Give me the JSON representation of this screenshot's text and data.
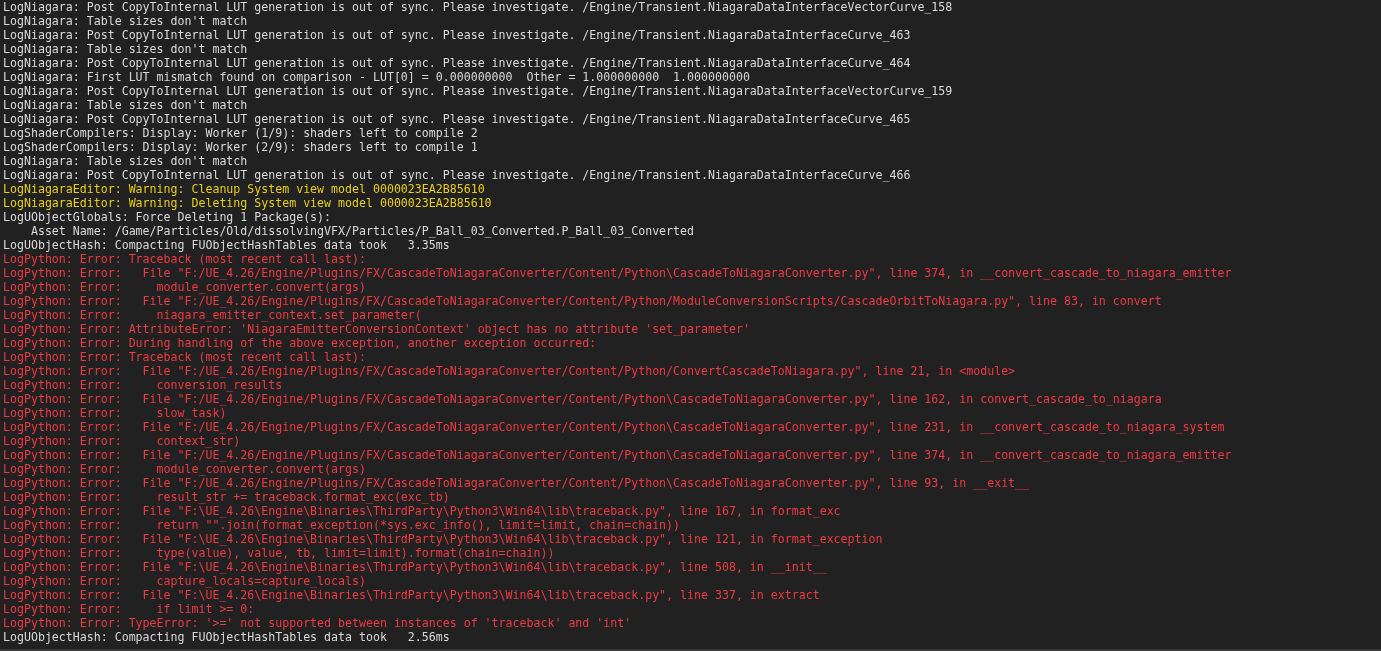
{
  "log_lines": [
    {
      "kind": "info",
      "text": "LogNiagara: Post CopyToInternal LUT generation is out of sync. Please investigate. /Engine/Transient.NiagaraDataInterfaceVectorCurve_158"
    },
    {
      "kind": "info",
      "text": "LogNiagara: Table sizes don't match"
    },
    {
      "kind": "info",
      "text": "LogNiagara: Post CopyToInternal LUT generation is out of sync. Please investigate. /Engine/Transient.NiagaraDataInterfaceCurve_463"
    },
    {
      "kind": "info",
      "text": "LogNiagara: Table sizes don't match"
    },
    {
      "kind": "info",
      "text": "LogNiagara: Post CopyToInternal LUT generation is out of sync. Please investigate. /Engine/Transient.NiagaraDataInterfaceCurve_464"
    },
    {
      "kind": "info",
      "text": "LogNiagara: First LUT mismatch found on comparison - LUT[0] = 0.000000000  Other = 1.000000000  1.000000000"
    },
    {
      "kind": "info",
      "text": "LogNiagara: Post CopyToInternal LUT generation is out of sync. Please investigate. /Engine/Transient.NiagaraDataInterfaceVectorCurve_159"
    },
    {
      "kind": "info",
      "text": "LogNiagara: Table sizes don't match"
    },
    {
      "kind": "info",
      "text": "LogNiagara: Post CopyToInternal LUT generation is out of sync. Please investigate. /Engine/Transient.NiagaraDataInterfaceCurve_465"
    },
    {
      "kind": "info",
      "text": "LogShaderCompilers: Display: Worker (1/9): shaders left to compile 2"
    },
    {
      "kind": "info",
      "text": "LogShaderCompilers: Display: Worker (2/9): shaders left to compile 1"
    },
    {
      "kind": "info",
      "text": "LogNiagara: Table sizes don't match"
    },
    {
      "kind": "info",
      "text": "LogNiagara: Post CopyToInternal LUT generation is out of sync. Please investigate. /Engine/Transient.NiagaraDataInterfaceCurve_466"
    },
    {
      "kind": "warning",
      "text": "LogNiagaraEditor: Warning: Cleanup System view model 0000023EA2B85610"
    },
    {
      "kind": "warning",
      "text": "LogNiagaraEditor: Warning: Deleting System view model 0000023EA2B85610"
    },
    {
      "kind": "info",
      "text": "LogUObjectGlobals: Force Deleting 1 Package(s):"
    },
    {
      "kind": "info",
      "text": "    Asset Name: /Game/Particles/Old/dissolvingVFX/Particles/P_Ball_03_Converted.P_Ball_03_Converted"
    },
    {
      "kind": "info",
      "text": "LogUObjectHash: Compacting FUObjectHashTables data took   3.35ms"
    },
    {
      "kind": "error",
      "text": "LogPython: Error: Traceback (most recent call last):"
    },
    {
      "kind": "error",
      "text": "LogPython: Error:   File \"F:/UE_4.26/Engine/Plugins/FX/CascadeToNiagaraConverter/Content/Python\\CascadeToNiagaraConverter.py\", line 374, in __convert_cascade_to_niagara_emitter"
    },
    {
      "kind": "error",
      "text": "LogPython: Error:     module_converter.convert(args)"
    },
    {
      "kind": "error",
      "text": "LogPython: Error:   File \"F:/UE_4.26/Engine/Plugins/FX/CascadeToNiagaraConverter/Content/Python/ModuleConversionScripts/CascadeOrbitToNiagara.py\", line 83, in convert"
    },
    {
      "kind": "error",
      "text": "LogPython: Error:     niagara_emitter_context.set_parameter("
    },
    {
      "kind": "error",
      "text": "LogPython: Error: AttributeError: 'NiagaraEmitterConversionContext' object has no attribute 'set_parameter'"
    },
    {
      "kind": "error",
      "text": "LogPython: Error: During handling of the above exception, another exception occurred:"
    },
    {
      "kind": "error",
      "text": "LogPython: Error: Traceback (most recent call last):"
    },
    {
      "kind": "error",
      "text": "LogPython: Error:   File \"F:/UE_4.26/Engine/Plugins/FX/CascadeToNiagaraConverter/Content/Python/ConvertCascadeToNiagara.py\", line 21, in <module>"
    },
    {
      "kind": "error",
      "text": "LogPython: Error:     conversion_results"
    },
    {
      "kind": "error",
      "text": "LogPython: Error:   File \"F:/UE_4.26/Engine/Plugins/FX/CascadeToNiagaraConverter/Content/Python\\CascadeToNiagaraConverter.py\", line 162, in convert_cascade_to_niagara"
    },
    {
      "kind": "error",
      "text": "LogPython: Error:     slow_task)"
    },
    {
      "kind": "error",
      "text": "LogPython: Error:   File \"F:/UE_4.26/Engine/Plugins/FX/CascadeToNiagaraConverter/Content/Python\\CascadeToNiagaraConverter.py\", line 231, in __convert_cascade_to_niagara_system"
    },
    {
      "kind": "error",
      "text": "LogPython: Error:     context_str)"
    },
    {
      "kind": "error",
      "text": "LogPython: Error:   File \"F:/UE_4.26/Engine/Plugins/FX/CascadeToNiagaraConverter/Content/Python\\CascadeToNiagaraConverter.py\", line 374, in __convert_cascade_to_niagara_emitter"
    },
    {
      "kind": "error",
      "text": "LogPython: Error:     module_converter.convert(args)"
    },
    {
      "kind": "error",
      "text": "LogPython: Error:   File \"F:/UE_4.26/Engine/Plugins/FX/CascadeToNiagaraConverter/Content/Python\\CascadeToNiagaraConverter.py\", line 93, in __exit__"
    },
    {
      "kind": "error",
      "text": "LogPython: Error:     result_str += traceback.format_exc(exc_tb)"
    },
    {
      "kind": "error",
      "text": "LogPython: Error:   File \"F:\\UE_4.26\\Engine\\Binaries\\ThirdParty\\Python3\\Win64\\lib\\traceback.py\", line 167, in format_exc"
    },
    {
      "kind": "error",
      "text": "LogPython: Error:     return \"\".join(format_exception(*sys.exc_info(), limit=limit, chain=chain))"
    },
    {
      "kind": "error",
      "text": "LogPython: Error:   File \"F:\\UE_4.26\\Engine\\Binaries\\ThirdParty\\Python3\\Win64\\lib\\traceback.py\", line 121, in format_exception"
    },
    {
      "kind": "error",
      "text": "LogPython: Error:     type(value), value, tb, limit=limit).format(chain=chain))"
    },
    {
      "kind": "error",
      "text": "LogPython: Error:   File \"F:\\UE_4.26\\Engine\\Binaries\\ThirdParty\\Python3\\Win64\\lib\\traceback.py\", line 508, in __init__"
    },
    {
      "kind": "error",
      "text": "LogPython: Error:     capture_locals=capture_locals)"
    },
    {
      "kind": "error",
      "text": "LogPython: Error:   File \"F:\\UE_4.26\\Engine\\Binaries\\ThirdParty\\Python3\\Win64\\lib\\traceback.py\", line 337, in extract"
    },
    {
      "kind": "error",
      "text": "LogPython: Error:     if limit >= 0:"
    },
    {
      "kind": "error",
      "text": "LogPython: Error: TypeError: '>=' not supported between instances of 'traceback' and 'int'"
    },
    {
      "kind": "info",
      "text": "LogUObjectHash: Compacting FUObjectHashTables data took   2.56ms"
    }
  ]
}
